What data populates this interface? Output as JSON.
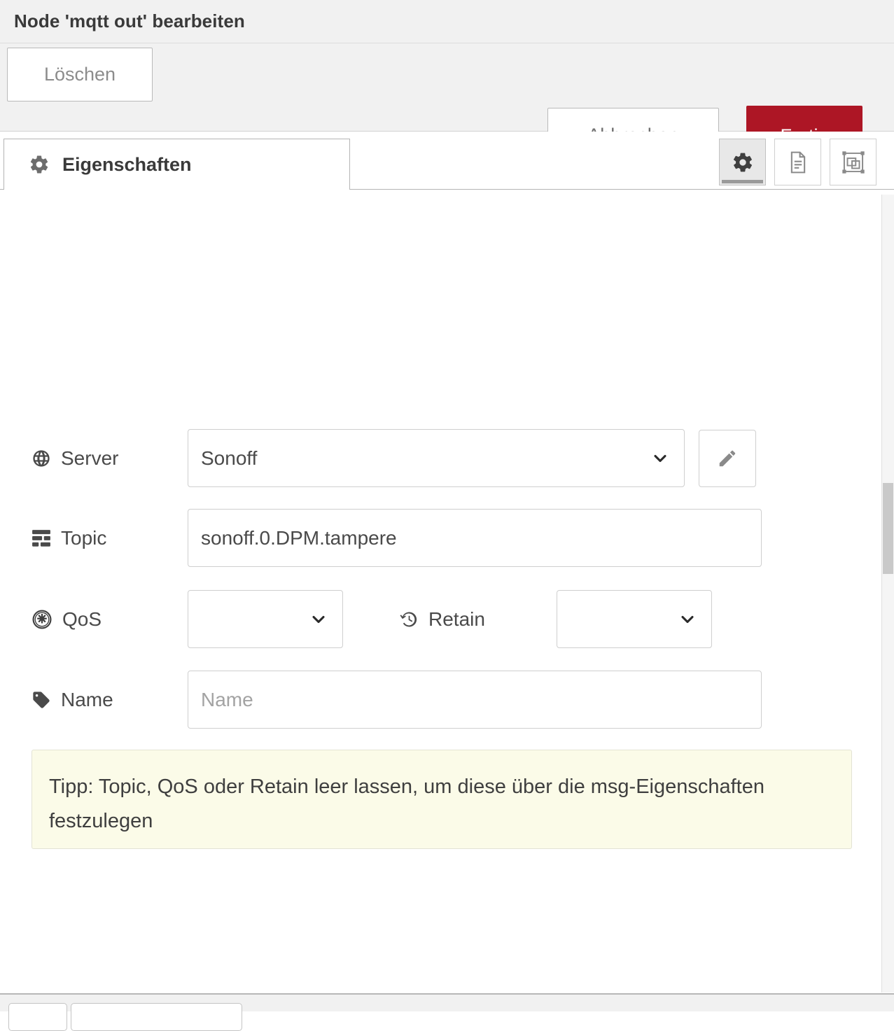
{
  "dialog": {
    "title": "Node 'mqtt out' bearbeiten"
  },
  "toolbar": {
    "delete_label": "Löschen",
    "cancel_label": "Abbrechen",
    "done_label": "Fertig",
    "done_color": "#ad1625"
  },
  "tabs": [
    {
      "label": "Eigenschaften",
      "icon": "gear-icon",
      "active": true
    }
  ],
  "tab_tools": [
    {
      "name": "properties-view-button",
      "icon": "gear-icon",
      "active": true
    },
    {
      "name": "description-view-button",
      "icon": "document-icon",
      "active": false
    },
    {
      "name": "appearance-view-button",
      "icon": "appearance-icon",
      "active": false
    }
  ],
  "form": {
    "server": {
      "label": "Server",
      "icon": "globe-icon",
      "value": "Sonoff",
      "edit_button_icon": "pencil-icon"
    },
    "topic": {
      "label": "Topic",
      "icon": "tasks-icon",
      "value": "sonoff.0.DPM.tampere"
    },
    "qos": {
      "label": "QoS",
      "icon": "empire-icon",
      "value": ""
    },
    "retain": {
      "label": "Retain",
      "icon": "history-icon",
      "value": ""
    },
    "name": {
      "label": "Name",
      "icon": "tag-icon",
      "value": "",
      "placeholder": "Name"
    }
  },
  "tip": {
    "text": "Tipp: Topic, QoS oder Retain leer lassen, um diese über die msg-Eigenschaften festzulegen",
    "background": "#fbfbe8"
  }
}
